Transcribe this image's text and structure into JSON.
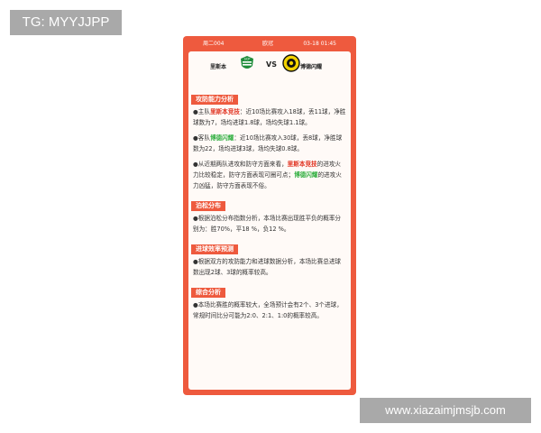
{
  "watermark_top_left": "TG: MYYJJPP",
  "watermark_bottom_right": "www.xiazaimjmsjb.com",
  "colors": {
    "accent": "#ee5a3e",
    "home": "#e0301e",
    "away": "#2fae3f"
  },
  "header": {
    "match_no": "周二004",
    "league": "欧冠",
    "datetime": "03-18 01:45"
  },
  "match": {
    "home": "里斯本",
    "vs": "VS",
    "away": "博德闪耀",
    "home_logo_icon": "sporting-crest-icon",
    "away_logo_icon": "bodo-glimt-crest-icon"
  },
  "sections": {
    "attack_defense": {
      "title": "攻防能力分析",
      "p1_prefix": "●主队",
      "p1_team": "里斯本竞技",
      "p1_text": "：近10场比赛攻入18球，丢11球，净胜球数为7，场均进球1.8球，场均失球1.1球。",
      "p2_prefix": "●客队",
      "p2_team": "博德闪耀",
      "p2_text": "：近10场比赛攻入30球，丢8球，净胜球数为22，场均进球3球，场均失球0.8球。",
      "p3_a": "●从近期两队进攻和防守方面来看，",
      "p3_home": "里斯本竞技",
      "p3_b": "的进攻火力比较稳定，防守方面表现可圈可点；",
      "p3_away": "博德闪耀",
      "p3_c": "的进攻火力凶猛，防守方面表现不俗。"
    },
    "poisson": {
      "title": "泊松分布",
      "text": "●根据泊松分布指数分析，本场比赛出现胜平负的概率分别为：胜70%，平18 %，负12 %。"
    },
    "goal_eff": {
      "title": "进球效率预测",
      "text": "●根据双方的攻防能力和进球数据分析，本场比赛总进球数出现2球、3球的概率较高。"
    },
    "summary": {
      "title": "综合分析",
      "text": "●本场比赛胜的概率较大，全场预计会有2个、3个进球，常规时间比分可能为2:0、2:1、1:0的概率较高。"
    }
  }
}
